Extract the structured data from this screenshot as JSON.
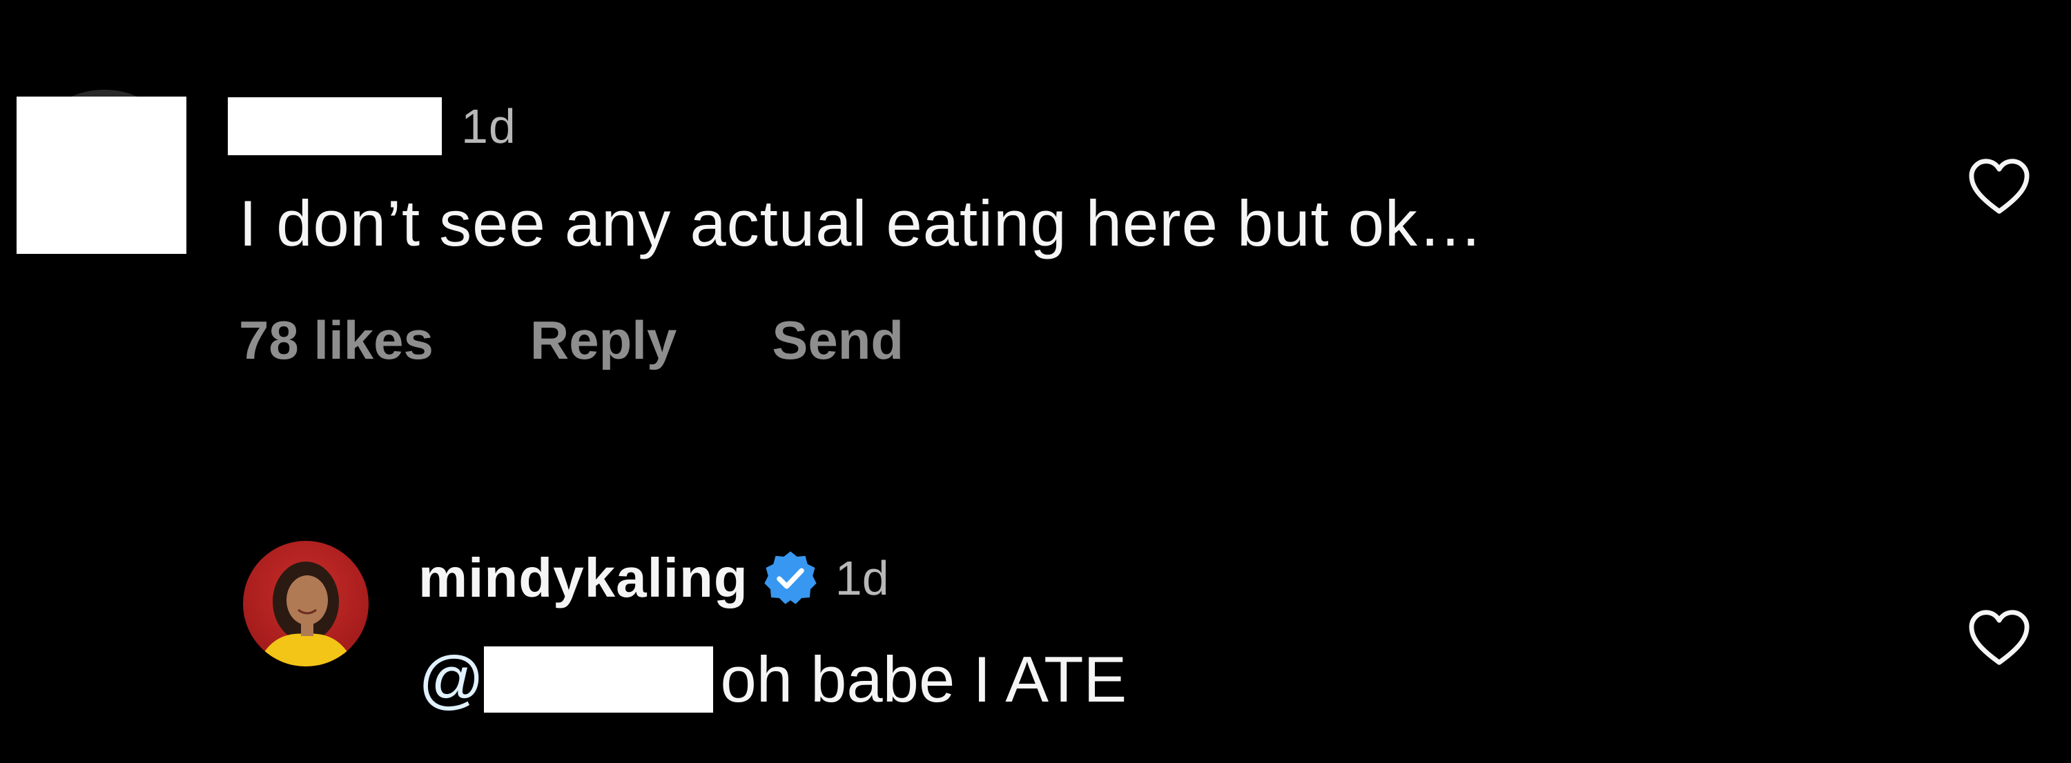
{
  "comments": [
    {
      "username": "",
      "username_redacted": true,
      "time": "1d",
      "text": "I don’t see any actual eating here but ok…",
      "likes": "78 likes",
      "reply_label": "Reply",
      "send_label": "Send",
      "like_icon": "heart-outline-icon"
    },
    {
      "username": "mindykaling",
      "verified": true,
      "time": "1d",
      "mention_prefix": "@",
      "mention_redacted": true,
      "text": "oh babe I ATE",
      "like_icon": "heart-outline-icon"
    }
  ],
  "colors": {
    "background": "#000000",
    "primary_text": "#f5f5f5",
    "secondary_text": "#8e8e8e",
    "verified_badge": "#3897f0",
    "redaction": "#ffffff"
  }
}
